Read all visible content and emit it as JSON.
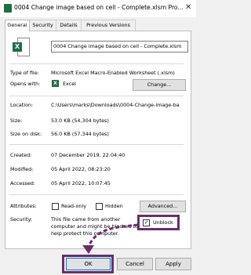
{
  "window": {
    "title": "0004 Change image based on cell - Complete.xlsm Pro...",
    "close_glyph": "✕"
  },
  "tabs": [
    {
      "label": "General"
    },
    {
      "label": "Security"
    },
    {
      "label": "Details"
    },
    {
      "label": "Previous Versions"
    }
  ],
  "file": {
    "name": "0004 Change image based on cell - Complete.xlsm",
    "excel_badge": "X"
  },
  "props": {
    "type_label": "Type of file:",
    "type_value": "Microsoft Excel Macro-Enabled Worksheet (.xlsm)",
    "opens_label": "Opens with:",
    "opens_value": "Excel",
    "change_button": "Change...",
    "location_label": "Location:",
    "location_value": "C:\\Users\\marks\\Downloads\\0004-Change-image-ba",
    "size_label": "Size:",
    "size_value": "53.0 KB (54,304 bytes)",
    "disk_label": "Size on disk:",
    "disk_value": "56.0 KB (57,344 bytes)",
    "created_label": "Created:",
    "created_value": "07 December 2019, 22:04:40",
    "modified_label": "Modified:",
    "modified_value": "05 April 2022, 08:23:20",
    "accessed_label": "Accessed:",
    "accessed_value": "05 April 2022, 10:07:45"
  },
  "attributes": {
    "label": "Attributes:",
    "readonly": "Read-only",
    "hidden": "Hidden",
    "advanced_button": "Advanced..."
  },
  "security": {
    "label": "Security:",
    "line1": "This file came from another",
    "line2": "computer and might be blocked to",
    "line3": "help protect this computer.",
    "unblock": "Unblock",
    "check": "✓"
  },
  "buttons": {
    "ok": "OK",
    "cancel": "Cancel",
    "apply": "Apply"
  },
  "colors": {
    "highlight": "#6b2d6b",
    "excel_green": "#1d6f42"
  }
}
